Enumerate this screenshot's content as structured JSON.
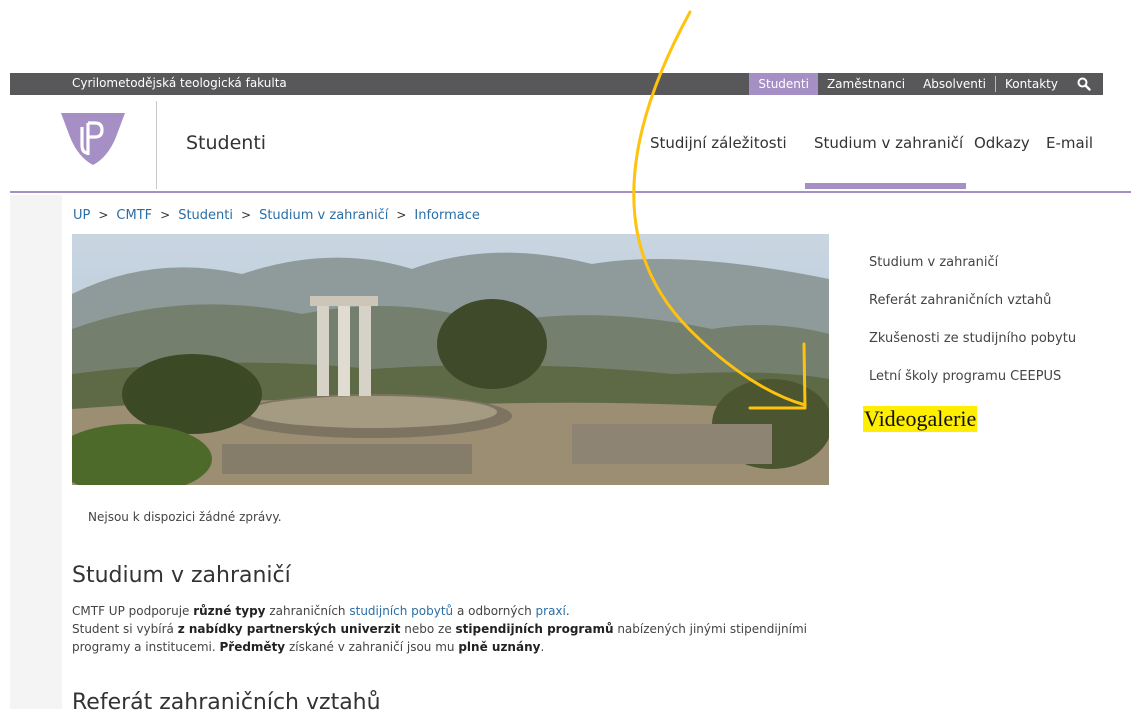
{
  "topbar": {
    "faculty": "Cyrilometodějská teologická fakulta",
    "links": [
      "Studenti",
      "Zaměstnanci",
      "Absolventi",
      "Kontakty"
    ],
    "active": "Studenti",
    "search_icon": "search-icon"
  },
  "header": {
    "logo_icon": "university-shield-logo",
    "site_title": "Studenti",
    "nav": [
      "Studijní záležitosti",
      "Studium v zahraničí",
      "Odkazy",
      "E-mail"
    ],
    "active_nav": "Studium v zahraničí"
  },
  "breadcrumb": {
    "items": [
      "UP",
      "CMTF",
      "Studenti",
      "Studium v zahraničí",
      "Informace"
    ],
    "separator": ">"
  },
  "sidebar": {
    "items": [
      "Studium v zahraničí",
      "Referát zahraničních vztahů",
      "Zkušenosti ze studijního pobytu",
      "Letní školy programu CEEPUS"
    ],
    "highlighted": "Videogalerie"
  },
  "main": {
    "no_news": "Nejsou k dispozici žádné zprávy.",
    "section1_title": "Studium v zahraničí",
    "p1": {
      "t1": "CMTF UP podporuje ",
      "b1": "různé typy",
      "t2": " zahraničních ",
      "l1": "studijních pobytů",
      "t3": " a odborných ",
      "l2": "praxí",
      "t4": "."
    },
    "p2": {
      "t1": "Student si vybírá ",
      "b1": "z nabídky partnerských univerzit",
      "t2": " nebo ze ",
      "b2": "stipendijních programů",
      "t3": " nabízených jinými stipendijními programy a institucemi. ",
      "b3": "Předměty",
      "t4": " získané v zahraničí jsou mu ",
      "b4": "plně uznány",
      "t5": "."
    },
    "section2_title": "Referát zahraničních vztahů"
  },
  "colors": {
    "accent": "#a58fc5",
    "topbar": "#58585a",
    "link": "#2a6ea6",
    "annotation_arrow": "#ffc20e",
    "highlight": "#ffee00"
  }
}
